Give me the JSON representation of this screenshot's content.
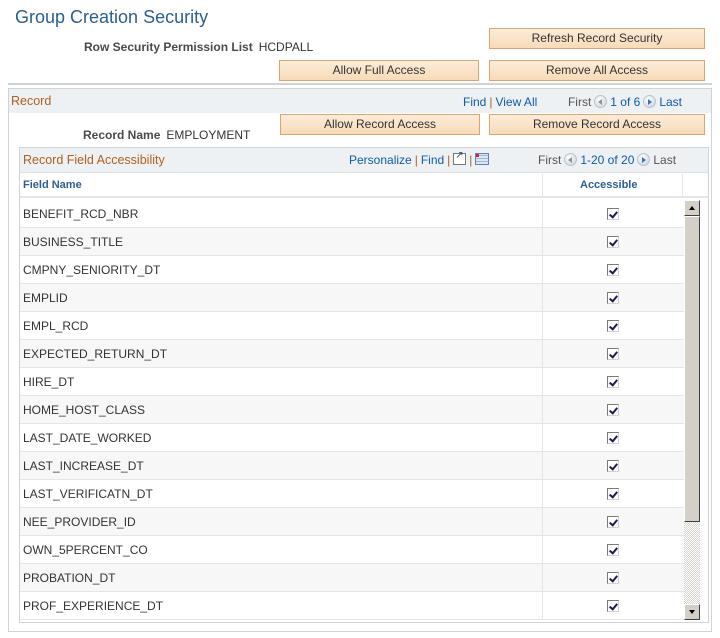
{
  "page": {
    "title": "Group Creation Security",
    "permission_list_label": "Row Security Permission List",
    "permission_list_value": "HCDPALL"
  },
  "buttons": {
    "refresh_record_security": "Refresh Record Security",
    "allow_full_access": "Allow Full Access",
    "remove_all_access": "Remove All Access",
    "allow_record_access": "Allow Record Access",
    "remove_record_access": "Remove Record Access"
  },
  "record": {
    "section_title": "Record",
    "find": "Find",
    "view_all": "View All",
    "first": "First",
    "position": "1 of 6",
    "last": "Last",
    "record_name_label": "Record Name",
    "record_name_value": "EMPLOYMENT"
  },
  "grid": {
    "title": "Record Field Accessibility",
    "personalize": "Personalize",
    "find": "Find",
    "zoom_icon": "new-window-icon",
    "download_icon": "download-to-excel-icon",
    "first": "First",
    "position": "1-20 of 20",
    "last": "Last",
    "columns": [
      "Field Name",
      "Accessible"
    ],
    "rows": [
      {
        "field": "BENEFIT_RCD_NBR",
        "accessible": true
      },
      {
        "field": "BUSINESS_TITLE",
        "accessible": true
      },
      {
        "field": "CMPNY_SENIORITY_DT",
        "accessible": true
      },
      {
        "field": "EMPLID",
        "accessible": true
      },
      {
        "field": "EMPL_RCD",
        "accessible": true
      },
      {
        "field": "EXPECTED_RETURN_DT",
        "accessible": true
      },
      {
        "field": "HIRE_DT",
        "accessible": true
      },
      {
        "field": "HOME_HOST_CLASS",
        "accessible": true
      },
      {
        "field": "LAST_DATE_WORKED",
        "accessible": true
      },
      {
        "field": "LAST_INCREASE_DT",
        "accessible": true
      },
      {
        "field": "LAST_VERIFICATN_DT",
        "accessible": true
      },
      {
        "field": "NEE_PROVIDER_ID",
        "accessible": true
      },
      {
        "field": "OWN_5PERCENT_CO",
        "accessible": true
      },
      {
        "field": "PROBATION_DT",
        "accessible": true
      },
      {
        "field": "PROF_EXPERIENCE_DT",
        "accessible": true
      }
    ]
  }
}
